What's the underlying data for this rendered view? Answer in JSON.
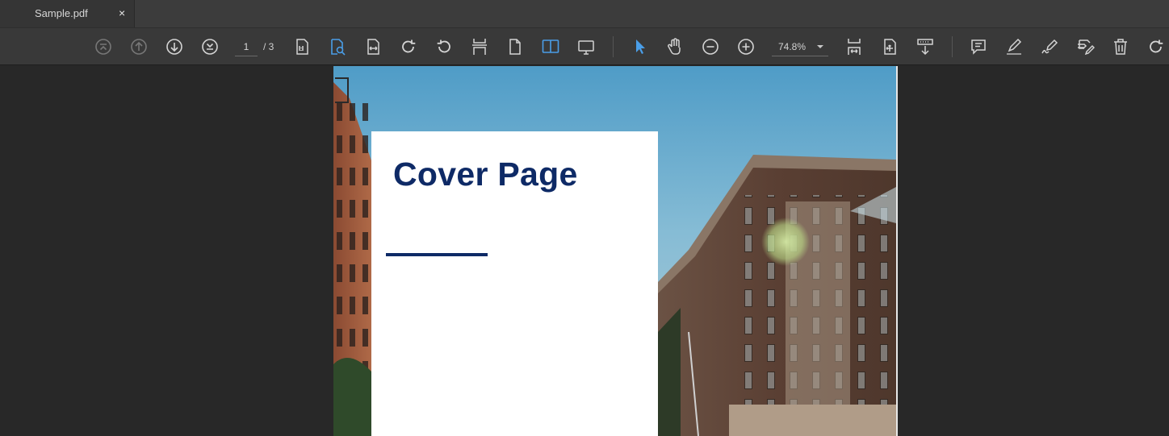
{
  "tab": {
    "title": "Sample.pdf",
    "close_glyph": "×"
  },
  "toolbar": {
    "page_current": "1",
    "page_total": "/ 3",
    "zoom": "74.8%",
    "accent_color": "#4a9ee8",
    "icons": [
      "first-page-icon",
      "previous-page-icon",
      "next-page-icon",
      "last-page-icon",
      "actual-size-icon",
      "fit-page-icon",
      "fit-width-icon",
      "rotate-clockwise-icon",
      "rotate-counterclockwise-icon",
      "split-view-icon",
      "single-page-icon",
      "two-page-icon",
      "presentation-icon",
      "select-tool-icon",
      "hand-tool-icon",
      "zoom-out-icon",
      "zoom-in-icon",
      "fit-height-icon",
      "crop-icon",
      "insert-page-icon",
      "comment-icon",
      "highlight-icon",
      "signature-icon",
      "edit-icon",
      "delete-icon",
      "redo-icon"
    ]
  },
  "document": {
    "cover_title": "Cover Page",
    "title_color": "#0e2a66"
  }
}
